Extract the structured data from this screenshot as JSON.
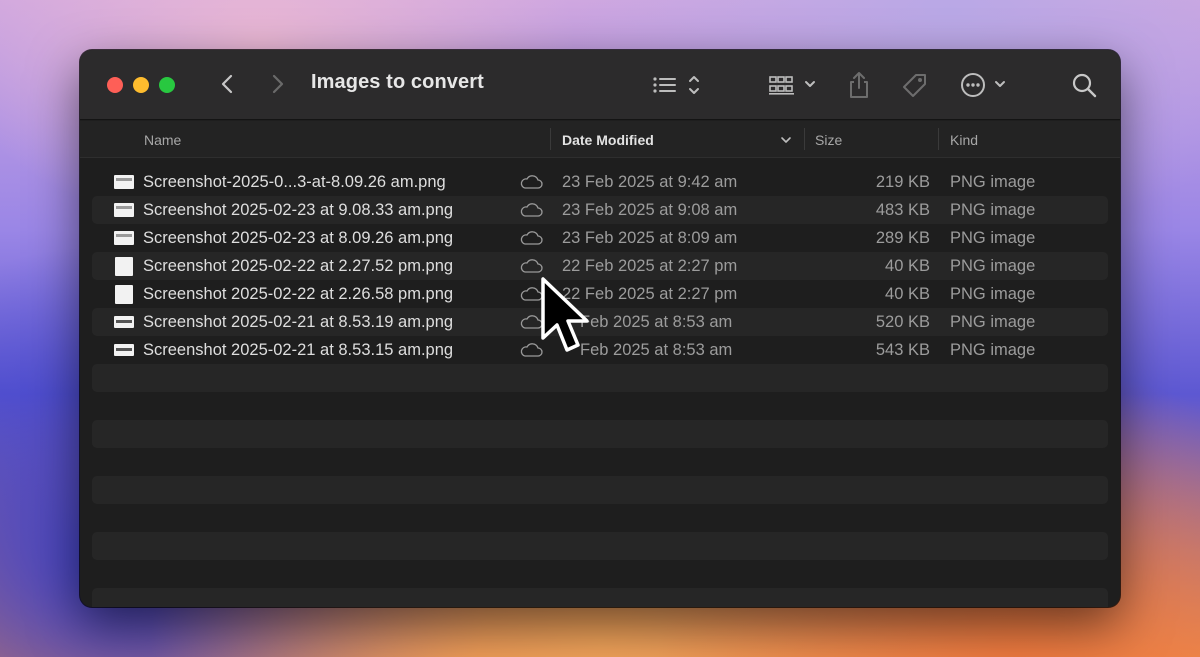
{
  "window": {
    "title": "Images to convert"
  },
  "toolbar": {
    "back_icon": "chevron-left-icon",
    "forward_icon": "chevron-right-icon",
    "view_icon": "list-view-icon",
    "group_icon": "group-grid-icon",
    "share_icon": "share-icon",
    "tag_icon": "tag-icon",
    "more_icon": "ellipsis-circle-icon",
    "search_icon": "search-icon"
  },
  "columns": {
    "name": "Name",
    "date": "Date Modified",
    "size": "Size",
    "kind": "Kind"
  },
  "files": [
    {
      "name": "Screenshot-2025-0...3-at-8.09.26 am.png",
      "date": "23 Feb 2025 at 9:42 am",
      "size": "219 KB",
      "kind": "PNG image",
      "icon": "wide"
    },
    {
      "name": "Screenshot 2025-02-23 at 9.08.33 am.png",
      "date": "23 Feb 2025 at 9:08 am",
      "size": "483 KB",
      "kind": "PNG image",
      "icon": "wide"
    },
    {
      "name": "Screenshot 2025-02-23 at 8.09.26 am.png",
      "date": "23 Feb 2025 at 8:09 am",
      "size": "289 KB",
      "kind": "PNG image",
      "icon": "wide"
    },
    {
      "name": "Screenshot 2025-02-22 at 2.27.52 pm.png",
      "date": "22 Feb 2025 at 2:27 pm",
      "size": "40 KB",
      "kind": "PNG image",
      "icon": "doc"
    },
    {
      "name": "Screenshot 2025-02-22 at 2.26.58 pm.png",
      "date": "22 Feb 2025 at 2:27 pm",
      "size": "40 KB",
      "kind": "PNG image",
      "icon": "doc"
    },
    {
      "name": "Screenshot 2025-02-21 at 8.53.19 am.png",
      "date": "Feb 2025 at 8:53 am",
      "size": "520 KB",
      "kind": "PNG image",
      "icon": "bar"
    },
    {
      "name": "Screenshot 2025-02-21 at 8.53.15 am.png",
      "date": "Feb 2025 at 8:53 am",
      "size": "543 KB",
      "kind": "PNG image",
      "icon": "bar"
    }
  ],
  "colors": {
    "window_bg": "#1e1e1e",
    "toolbar_bg": "#2c2b2c",
    "close": "#fe5f57",
    "minimize": "#febc2e",
    "maximize": "#28c840"
  }
}
